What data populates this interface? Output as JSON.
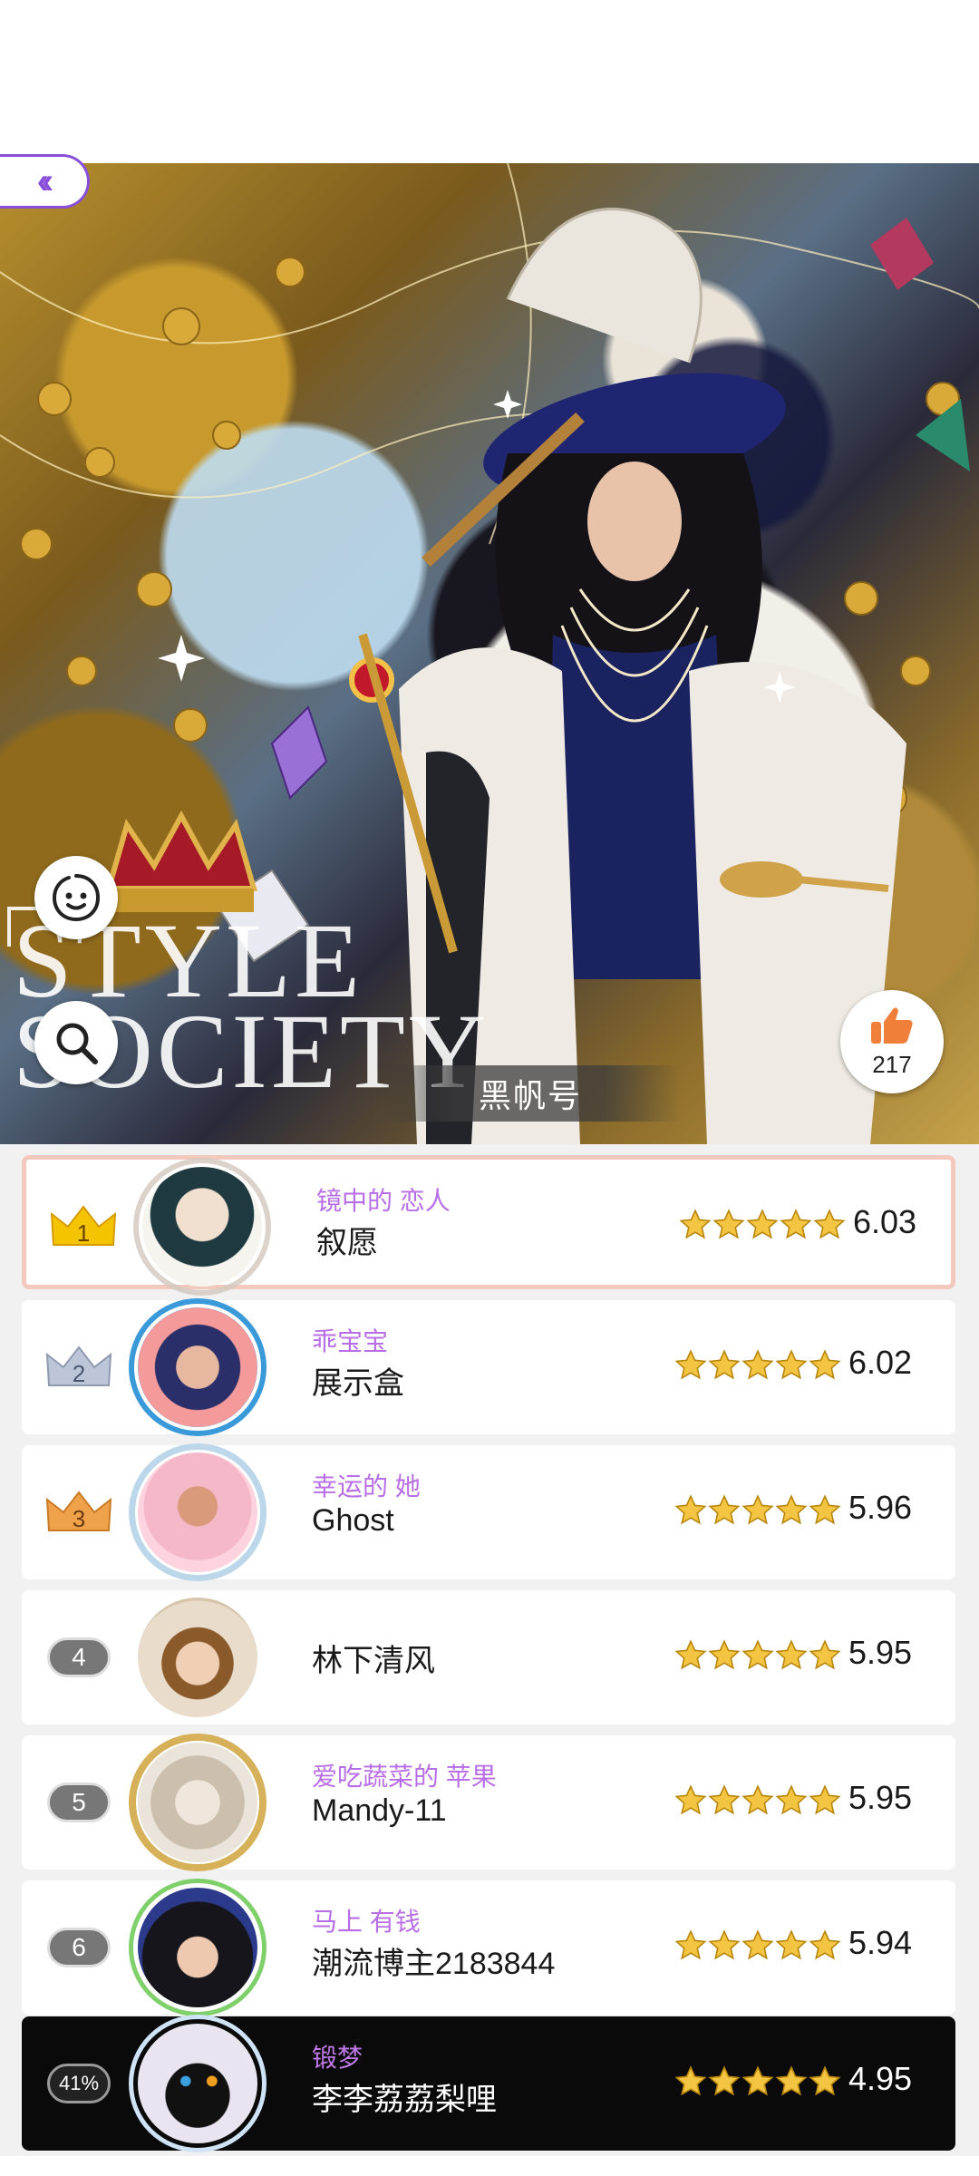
{
  "outfit": {
    "title": "黑帆号",
    "like_count": "217",
    "logo_line1": "STYLE",
    "logo_line2": "SOCIETY"
  },
  "icons": {
    "back": "double-chevron-left-icon",
    "emoji": "smiley-face-icon",
    "search": "magnifier-icon",
    "like": "thumbs-up-icon"
  },
  "colors": {
    "accent": "#8a4fd8",
    "name_purple": "#b86ee6",
    "star_gold": "#f4c542",
    "like_orange": "#f07f3a"
  },
  "ranking": [
    {
      "rank": "1",
      "nickname": "镜中的 恋人",
      "name": "叙愿",
      "score": "6.03",
      "stars": 5
    },
    {
      "rank": "2",
      "nickname": "乖宝宝",
      "name": "展示盒",
      "score": "6.02",
      "stars": 5
    },
    {
      "rank": "3",
      "nickname": "幸运的 她",
      "name": "Ghost",
      "score": "5.96",
      "stars": 5
    },
    {
      "rank": "4",
      "nickname": "",
      "name": "林下清风",
      "score": "5.95",
      "stars": 5
    },
    {
      "rank": "5",
      "nickname": "爱吃蔬菜的 苹果",
      "name": "Mandy-11",
      "score": "5.95",
      "stars": 5
    },
    {
      "rank": "6",
      "nickname": "马上 有钱",
      "name": "潮流博主2183844",
      "score": "5.94",
      "stars": 5
    }
  ],
  "my_entry": {
    "percentile": "41%",
    "nickname": "锻梦",
    "name": "李李荔荔梨哩",
    "score": "4.95",
    "stars": 5
  }
}
